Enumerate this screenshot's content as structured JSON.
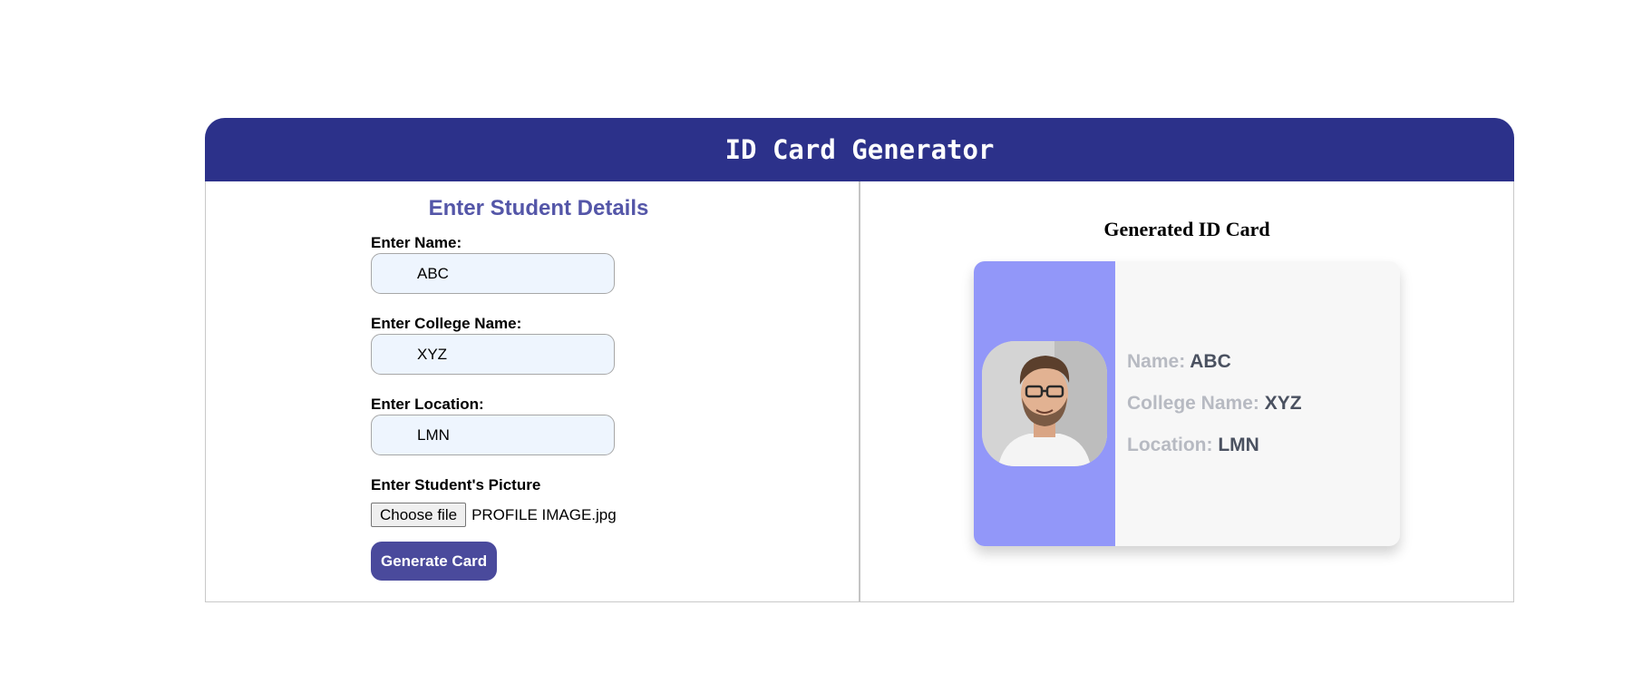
{
  "app": {
    "title": "ID Card Generator"
  },
  "form": {
    "heading": "Enter Student Details",
    "name_label": "Enter Name:",
    "name_value": "ABC",
    "college_label": "Enter College Name:",
    "college_value": "XYZ",
    "location_label": "Enter Location:",
    "location_value": "LMN",
    "picture_label": "Enter Student's Picture",
    "file_button_label": "Choose file",
    "file_name": "PROFILE IMAGE.jpg",
    "generate_label": "Generate Card"
  },
  "card": {
    "heading": "Generated ID Card",
    "name_label": "Name:",
    "name_value": "ABC",
    "college_label": "College Name:",
    "college_value": "XYZ",
    "location_label": "Location:",
    "location_value": "LMN",
    "photo_icon": "profile-photo",
    "strip_color": "#9297f9"
  },
  "colors": {
    "header": "#2c318a",
    "form_heading": "#5456a8",
    "button": "#4a4a9c",
    "input_background": "#eef5fe"
  }
}
